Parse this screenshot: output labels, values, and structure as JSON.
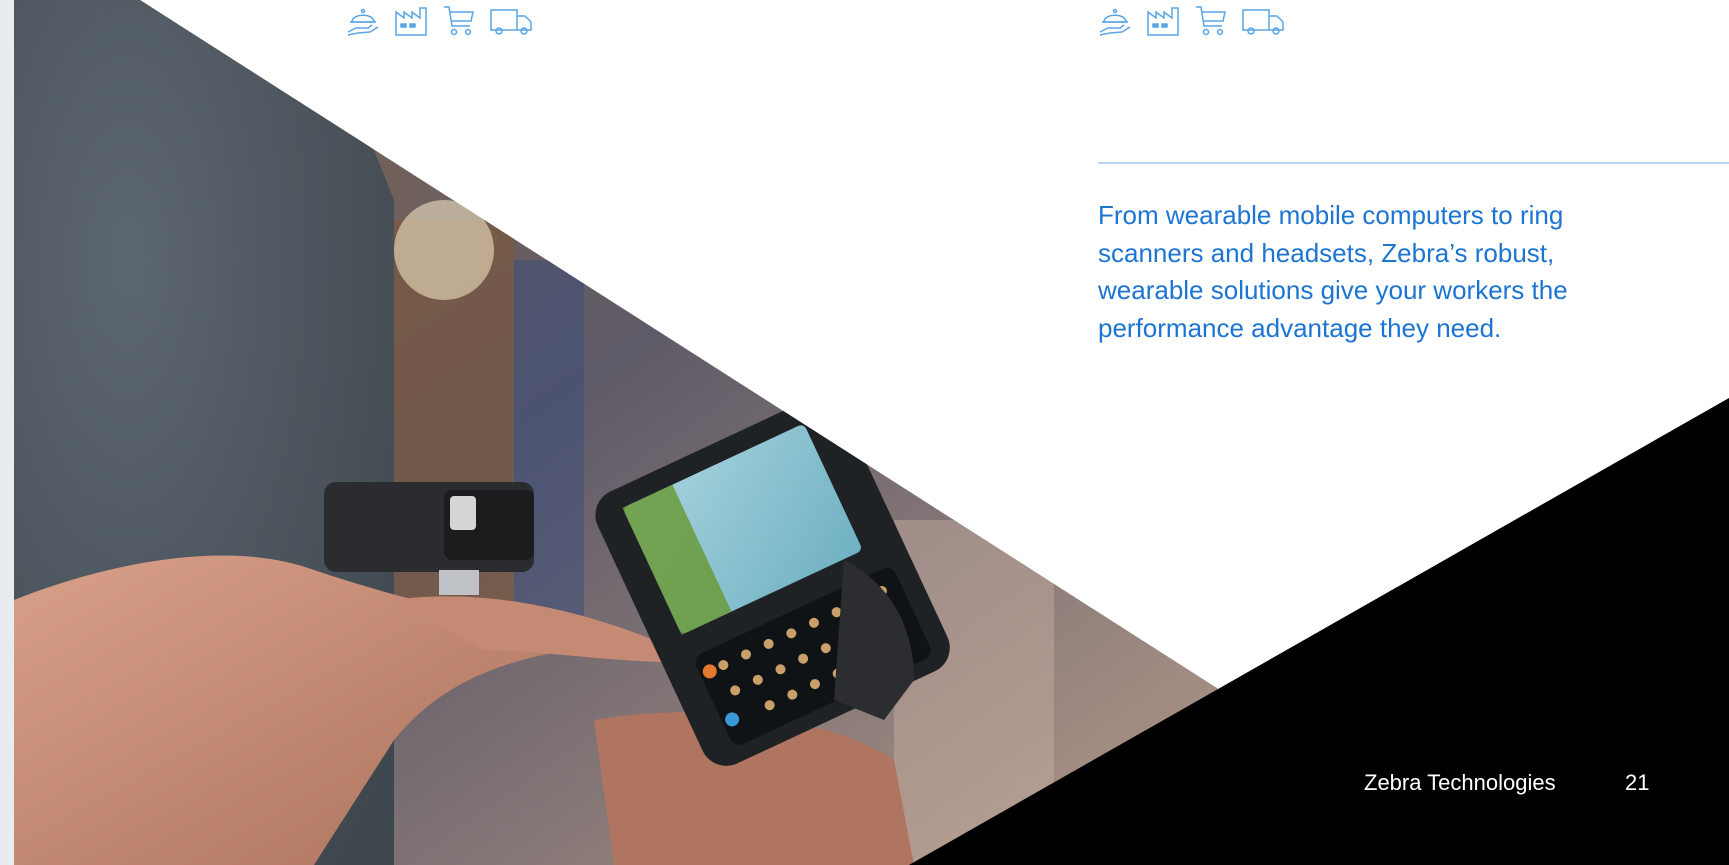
{
  "icons": {
    "left_row": [
      "food-service-icon",
      "factory-icon",
      "shopping-cart-icon",
      "delivery-truck-icon"
    ],
    "right_row": [
      "food-service-icon",
      "factory-icon",
      "shopping-cart-icon",
      "delivery-truck-icon"
    ],
    "color": "#5aa5e6"
  },
  "content": {
    "intro_text": "From wearable mobile computers to ring scanners and headsets, Zebra’s robust, wearable solutions give your workers the performance advantage they need."
  },
  "footer": {
    "company": "Zebra Technologies",
    "page_number": "21"
  },
  "colors": {
    "accent_text": "#1c74d3",
    "rule": "#b6d8f5",
    "footer_text": "#ffffff",
    "wedge": "#000000"
  }
}
